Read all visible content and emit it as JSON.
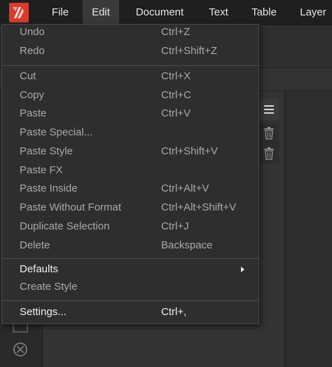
{
  "menubar": {
    "items": [
      {
        "label": "File"
      },
      {
        "label": "Edit"
      },
      {
        "label": "Document"
      },
      {
        "label": "Text"
      },
      {
        "label": "Table"
      },
      {
        "label": "Layer"
      }
    ],
    "active": "Edit"
  },
  "edit_menu": {
    "items": [
      {
        "label": "Undo",
        "shortcut": "Ctrl+Z",
        "enabled": false
      },
      {
        "label": "Redo",
        "shortcut": "Ctrl+Shift+Z",
        "enabled": false
      },
      {
        "label": "Cut",
        "shortcut": "Ctrl+X",
        "enabled": false
      },
      {
        "label": "Copy",
        "shortcut": "Ctrl+C",
        "enabled": false
      },
      {
        "label": "Paste",
        "shortcut": "Ctrl+V",
        "enabled": false
      },
      {
        "label": "Paste Special...",
        "shortcut": "",
        "enabled": false
      },
      {
        "label": "Paste Style",
        "shortcut": "Ctrl+Shift+V",
        "enabled": false
      },
      {
        "label": "Paste FX",
        "shortcut": "",
        "enabled": false
      },
      {
        "label": "Paste Inside",
        "shortcut": "Ctrl+Alt+V",
        "enabled": false
      },
      {
        "label": "Paste Without Format",
        "shortcut": "Ctrl+Alt+Shift+V",
        "enabled": false
      },
      {
        "label": "Duplicate Selection",
        "shortcut": "Ctrl+J",
        "enabled": false
      },
      {
        "label": "Delete",
        "shortcut": "Backspace",
        "enabled": false
      },
      {
        "label": "Defaults",
        "shortcut": "",
        "enabled": true,
        "submenu": true
      },
      {
        "label": "Create Style",
        "shortcut": "",
        "enabled": false
      },
      {
        "label": "Settings...",
        "shortcut": "Ctrl+,",
        "enabled": true
      }
    ]
  },
  "icons": {
    "logo": "affinity-publisher-logo",
    "panel_menu": "hamburger-icon",
    "trash": "trash-icon",
    "tool": "circle-x-icon"
  },
  "colors": {
    "menubar_bg": "#1f1f1f",
    "menu_bg": "#2e2e2e",
    "logo_red": "#d93c2c",
    "text_enabled": "#f0f0f0",
    "text_disabled": "#a9a9a9"
  }
}
